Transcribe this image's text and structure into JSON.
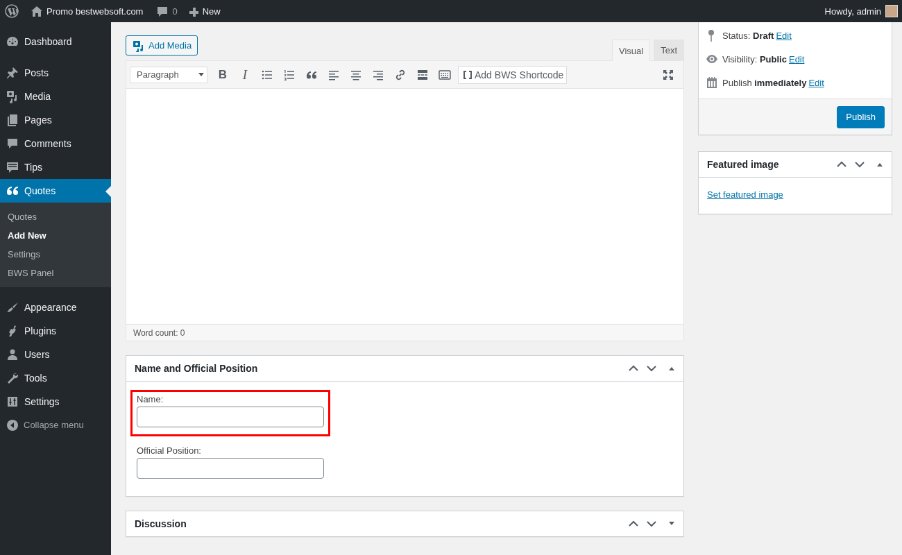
{
  "admin_bar": {
    "site_name": "Promo bestwebsoft.com",
    "comments_count": "0",
    "new_label": "New",
    "greeting": "Howdy, admin"
  },
  "sidebar": {
    "items": [
      {
        "label": "Dashboard",
        "current": false
      },
      {
        "label": "Posts",
        "current": false
      },
      {
        "label": "Media",
        "current": false
      },
      {
        "label": "Pages",
        "current": false
      },
      {
        "label": "Comments",
        "current": false
      },
      {
        "label": "Tips",
        "current": false
      },
      {
        "label": "Quotes",
        "current": true,
        "children": [
          {
            "label": "Quotes",
            "selected": false
          },
          {
            "label": "Add New",
            "selected": true
          },
          {
            "label": "Settings",
            "selected": false
          },
          {
            "label": "BWS Panel",
            "selected": false
          }
        ]
      },
      {
        "label": "Appearance",
        "current": false
      },
      {
        "label": "Plugins",
        "current": false
      },
      {
        "label": "Users",
        "current": false
      },
      {
        "label": "Tools",
        "current": false
      },
      {
        "label": "Settings",
        "current": false
      }
    ],
    "collapse_label": "Collapse menu"
  },
  "editor": {
    "add_media": "Add Media",
    "tabs": [
      {
        "label": "Visual",
        "selected": true
      },
      {
        "label": "Text",
        "selected": false
      }
    ],
    "format_select": "Paragraph",
    "bold_label": "B",
    "italic_label": "I",
    "shortcode_button": "Add BWS Shortcode",
    "word_count": "Word count: 0"
  },
  "metaboxes": [
    {
      "title": "Name and Official Position",
      "expanded": true,
      "fields": [
        {
          "label": "Name:",
          "highlighted": true
        },
        {
          "label": "Official Position:",
          "highlighted": false
        }
      ]
    },
    {
      "title": "Discussion",
      "expanded": false
    }
  ],
  "publish_box": {
    "rows": [
      {
        "text": "Status: **Draft**",
        "link": "Edit"
      },
      {
        "text": "Visibility: **Public**",
        "link": "Edit"
      },
      {
        "text": "Publish **immediately**",
        "link": "Edit"
      }
    ],
    "button": "Publish"
  },
  "featured_image": {
    "title": "Featured image",
    "expanded": true,
    "link": "Set featured image"
  }
}
